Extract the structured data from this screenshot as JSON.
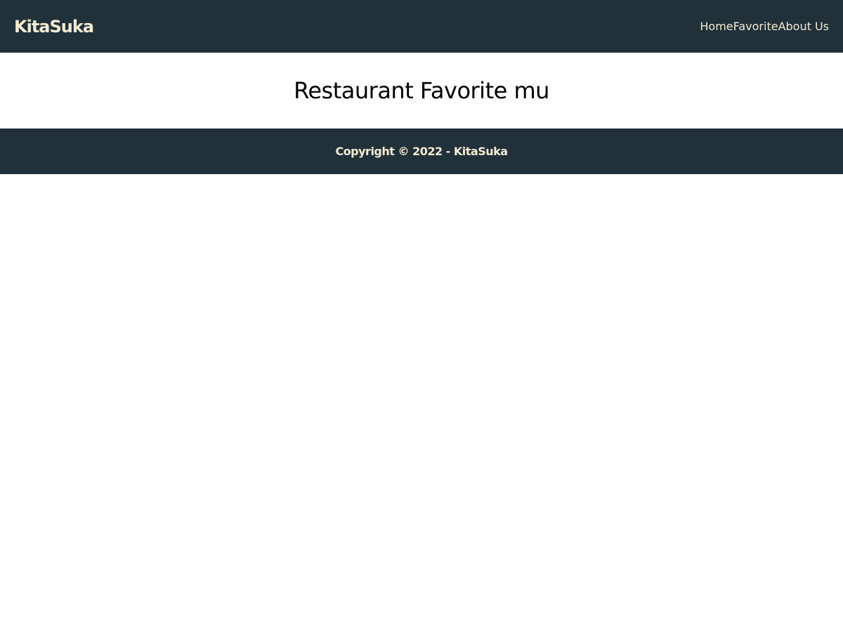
{
  "header": {
    "brand": "KitaSuka",
    "nav": {
      "home": "Home",
      "favorite": "Favorite",
      "about": "About Us"
    }
  },
  "main": {
    "title": "Restaurant Favorite mu"
  },
  "footer": {
    "copyright": "Copyright © 2022 - KitaSuka"
  },
  "colors": {
    "header_bg": "#21313a",
    "accent_text": "#f2ebd3",
    "page_bg": "#ffffff"
  }
}
